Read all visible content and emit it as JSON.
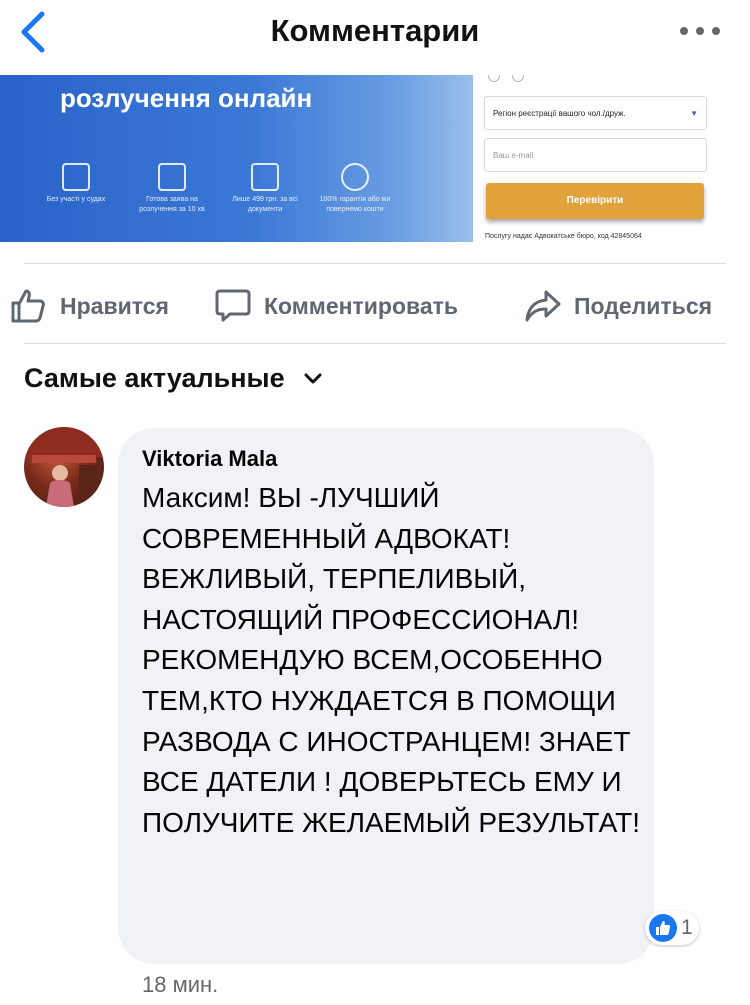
{
  "header": {
    "title": "Комментарии"
  },
  "ad": {
    "headline": "розлучення онлайн",
    "features": [
      "Без участі у судах",
      "Готова заява на розлучення за 10 хв",
      "Лише 499 грн. за всі документи",
      "100% гарантія або ми повернемо кошти"
    ],
    "region_select": "Регіон реєстрації вашого чол./друж.",
    "email_placeholder": "Ваш e-mail",
    "check_button": "Перевірити",
    "provider_note": "Послугу надає Адвокатське бюро, код 42845064"
  },
  "actions": {
    "like": "Нравится",
    "comment": "Комментировать",
    "share": "Поделиться"
  },
  "sort": {
    "label": "Самые актуальные"
  },
  "comment": {
    "author": "Viktoria Mala",
    "text": "Максим! ВЫ -ЛУЧШИЙ СОВРЕМЕННЫЙ АДВОКАТ! ВЕЖЛИВЫЙ, ТЕРПЕЛИВЫЙ, НАСТОЯЩИЙ ПРОФЕССИОНАЛ! РЕКОМЕНДУЮ ВСЕМ,ОСОБЕННО ТЕМ,КТО НУЖДАЕТСЯ В ПОМОЩИ РАЗВОДА С ИНОСТРАНЦЕМ! ЗНАЕТ ВСЕ ДАТЕЛИ ! ДОВЕРЬТЕСЬ ЕМУ И ПОЛУЧИТЕ ЖЕЛАЕМЫЙ РЕЗУЛЬТАТ!",
    "reaction_count": "1",
    "time": "18 мин."
  },
  "colors": {
    "accent": "#1877f2",
    "icon_gray": "#606770",
    "bubble_bg": "#f0f2f5",
    "button_gold": "#e2a23b"
  },
  "icons": [
    "back-chevron-icon",
    "more-dots-icon",
    "like-thumb-icon",
    "comment-bubble-icon",
    "share-arrow-icon",
    "chevron-down-icon"
  ]
}
